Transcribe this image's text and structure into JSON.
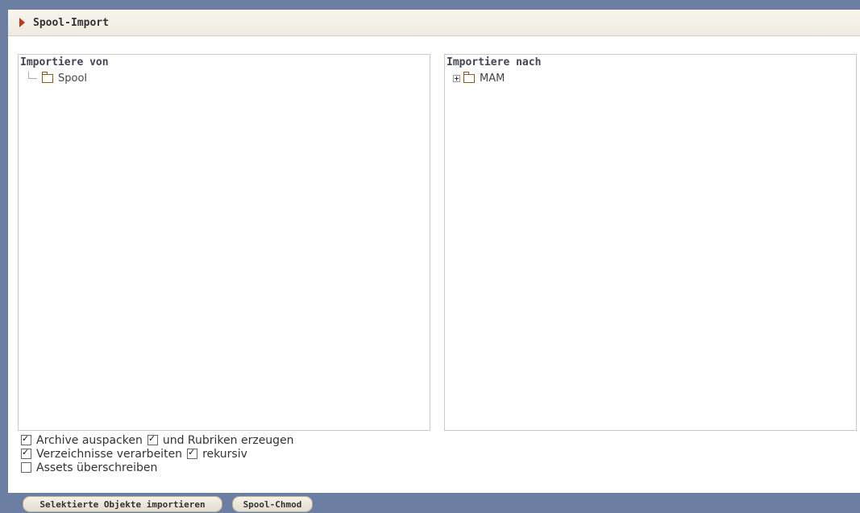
{
  "header": {
    "title": "Spool-Import"
  },
  "left_panel": {
    "heading": "Importiere von",
    "tree": [
      {
        "label": "Spool",
        "icon": "folder-icon"
      }
    ]
  },
  "right_panel": {
    "heading": "Importiere nach",
    "tree": [
      {
        "label": "MAM",
        "icon": "folder-icon",
        "expandable": true
      }
    ]
  },
  "options": {
    "archive_unpack": {
      "label": "Archive auspacken",
      "checked": true
    },
    "create_rubrics": {
      "label": "und Rubriken erzeugen",
      "checked": true
    },
    "process_dirs": {
      "label": "Verzeichnisse verarbeiten",
      "checked": true
    },
    "recursive": {
      "label": "rekursiv",
      "checked": true
    },
    "overwrite_assets": {
      "label": "Assets überschreiben",
      "checked": false
    }
  },
  "buttons": {
    "import": "Selektierte Objekte importieren",
    "chmod": "Spool-Chmod"
  },
  "colors": {
    "accent": "#c0391c",
    "chrome": "#6c7fa3"
  }
}
